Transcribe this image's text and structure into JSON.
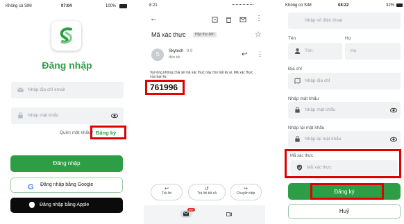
{
  "login": {
    "status": {
      "carrier": "Không có SIM",
      "time": "07:04",
      "battery": "100%"
    },
    "title": "Đăng nhập",
    "email_placeholder": "Nhập địa chỉ email",
    "password_placeholder": "Nhập mật khẩu",
    "forgot": "Quên mật khẩu?",
    "register": "Đăng ký",
    "login_button": "Đăng nhập",
    "google_button": "Đăng nhập bằng Google",
    "apple_button": "Đăng nhập bằng Apple",
    "colors": {
      "brand": "#2e9e46",
      "highlight": "#e00000"
    }
  },
  "email": {
    "status": {
      "time": "8:21"
    },
    "subject": "Mã xác thực",
    "inbox_label": "Hộp thư đến",
    "sender": "Skytech",
    "sender_time": "9:9",
    "to_line": "đến tôi",
    "avatar_letter": "S",
    "body": "Vui lòng không chia sẻ mã xác thực này cho bất kỳ ai. Mã xác thực của bạn là:",
    "code": "761996",
    "reply": "Trả lời",
    "reply_all": "Trả lời tất cả",
    "forward": "Chuyển tiếp",
    "mail_badge": "99+"
  },
  "register": {
    "status": {
      "carrier": "Không có SIM",
      "time": "08:22",
      "battery": "32%"
    },
    "phone_placeholder": "Nhập số điện thoại",
    "first_name_label": "Tên",
    "last_name_label": "Họ",
    "first_name_placeholder": "Tên",
    "last_name_placeholder": "Họ",
    "address_label": "Địa chỉ",
    "address_placeholder": "Nhập địa chỉ",
    "password_label": "Nhập mật khẩu",
    "password_placeholder": "Nhập mật khẩu",
    "confirm_label": "Nhập lại mật khẩu",
    "confirm_placeholder": "Nhập lại mật khẩu",
    "code_label": "Mã xác thực",
    "code_placeholder": "Mã xác thực",
    "register_button": "Đăng ký",
    "cancel_button": "Huỷ"
  }
}
